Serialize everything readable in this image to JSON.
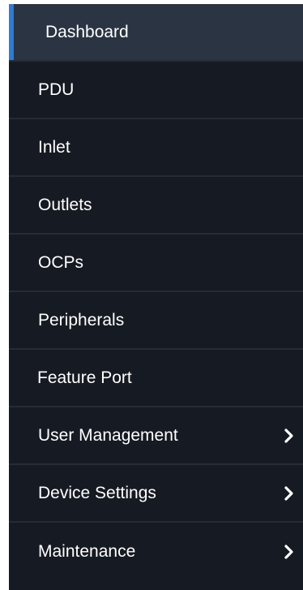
{
  "sidebar": {
    "items": [
      {
        "label": "Dashboard",
        "icon": null,
        "active": true
      },
      {
        "label": "PDU",
        "icon": null
      },
      {
        "label": "Inlet",
        "icon": null
      },
      {
        "label": "Outlets",
        "icon": null
      },
      {
        "label": "OCPs",
        "icon": null
      },
      {
        "label": "Peripherals",
        "icon": null
      },
      {
        "label": "Feature Port",
        "icon": null
      },
      {
        "label": "User Management",
        "icon": "chevron-right-icon"
      },
      {
        "label": "Device Settings",
        "icon": "chevron-right-icon"
      },
      {
        "label": "Maintenance",
        "icon": "chevron-right-icon"
      }
    ]
  },
  "colors": {
    "background": "#161a22",
    "active_background": "#2b3442",
    "active_indicator": "#2e7bd1",
    "divider": "#262c36",
    "text": "#ffffff"
  }
}
